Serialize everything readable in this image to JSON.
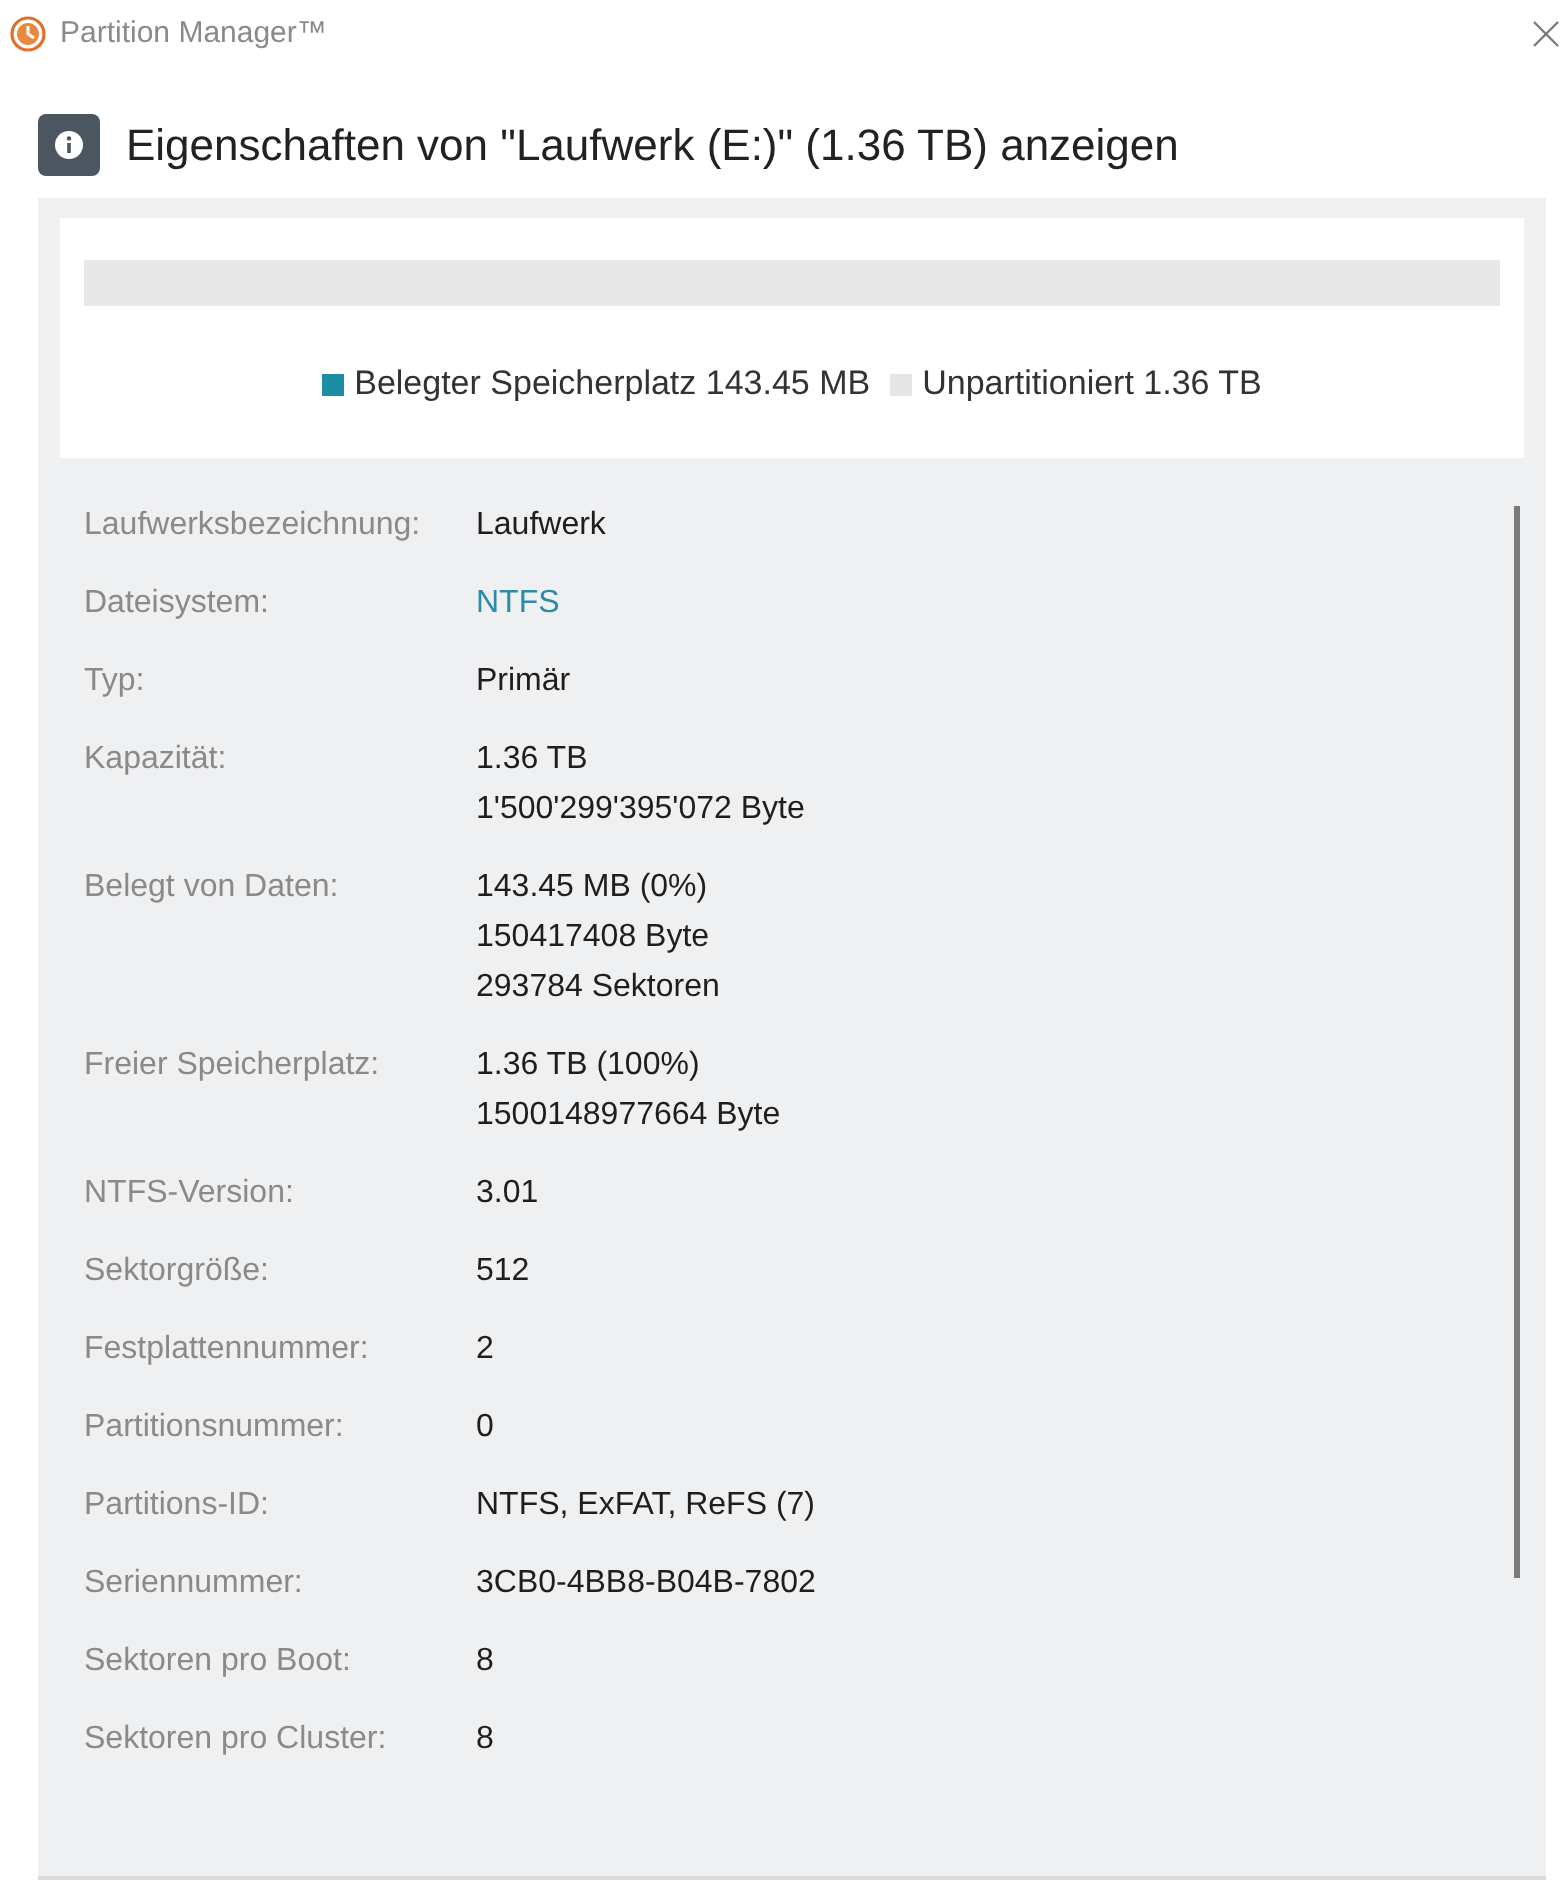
{
  "window": {
    "title": "Partition Manager™"
  },
  "header": {
    "title": "Eigenschaften von \"Laufwerk (E:)\" (1.36 TB) anzeigen"
  },
  "usage": {
    "level": 0,
    "legend": [
      {
        "label": "Belegter Speicherplatz 143.45 MB",
        "color": "#1b8ea3"
      },
      {
        "label": "Unpartitioniert 1.36 TB",
        "color": "#e6e6e6"
      }
    ]
  },
  "properties": [
    {
      "label": "Laufwerksbezeichnung:",
      "values": [
        "Laufwerk"
      ],
      "link": false
    },
    {
      "label": "Dateisystem:",
      "values": [
        "NTFS"
      ],
      "link": true
    },
    {
      "label": "Typ:",
      "values": [
        "Primär"
      ],
      "link": false
    },
    {
      "label": "Kapazität:",
      "values": [
        "1.36 TB",
        "1'500'299'395'072 Byte"
      ],
      "link": false
    },
    {
      "label": "Belegt von Daten:",
      "values": [
        "143.45 MB (0%)",
        "150417408 Byte",
        "293784 Sektoren"
      ],
      "link": false
    },
    {
      "label": "Freier Speicherplatz:",
      "values": [
        "1.36 TB (100%)",
        "1500148977664 Byte"
      ],
      "link": false
    },
    {
      "label": "NTFS-Version:",
      "values": [
        "3.01"
      ],
      "link": false
    },
    {
      "label": "Sektorgröße:",
      "values": [
        "512"
      ],
      "link": false
    },
    {
      "label": "Festplattennummer:",
      "values": [
        "2"
      ],
      "link": false
    },
    {
      "label": "Partitionsnummer:",
      "values": [
        "0"
      ],
      "link": false
    },
    {
      "label": "Partitions-ID:",
      "values": [
        "NTFS, ExFAT, ReFS (7)"
      ],
      "link": false
    },
    {
      "label": "Seriennummer:",
      "values": [
        "3CB0-4BB8-B04B-7802"
      ],
      "link": false
    },
    {
      "label": "Sektoren pro Boot:",
      "values": [
        "8"
      ],
      "link": false
    },
    {
      "label": "Sektoren pro Cluster:",
      "values": [
        "8"
      ],
      "link": false
    }
  ]
}
